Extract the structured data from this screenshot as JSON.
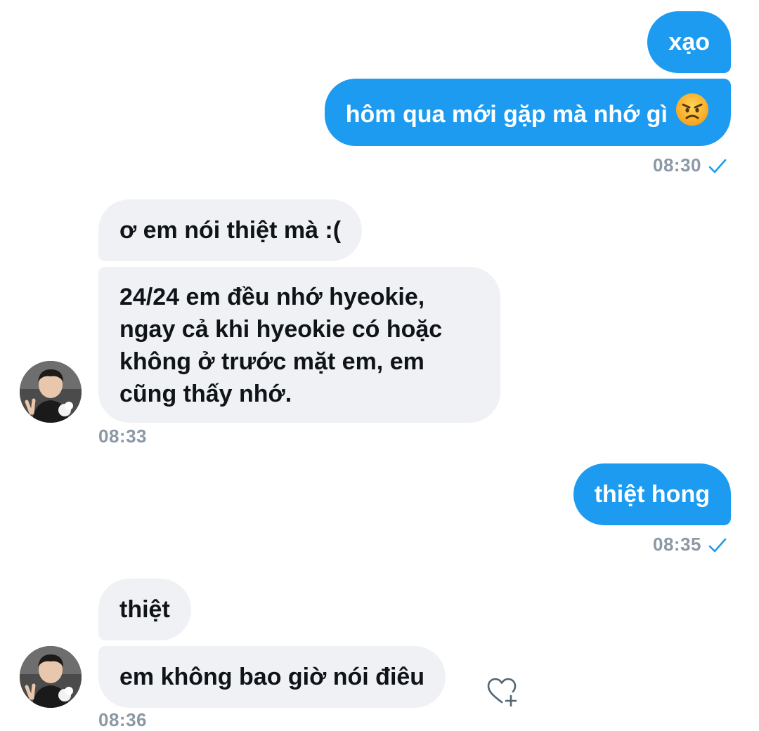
{
  "colors": {
    "outgoing_bubble": "#1d9bf0",
    "incoming_bubble": "#eff1f4",
    "timestamp": "#8b98a5",
    "read_check": "#1d9bf0"
  },
  "messages": [
    {
      "direction": "outgoing",
      "text": "xạo"
    },
    {
      "direction": "outgoing",
      "text": "hôm qua mới gặp mà nhớ gì",
      "emoji": "angry-face-icon",
      "time": "08:30"
    },
    {
      "direction": "incoming",
      "text": "ơ em nói thiệt mà :("
    },
    {
      "direction": "incoming",
      "lines": [
        "24/24 em đều nhớ hyeokie,",
        "ngay cả khi hyeokie có hoặc",
        "không ở trước mặt em, em",
        "cũng thấy nhớ."
      ],
      "time": "08:33"
    },
    {
      "direction": "outgoing",
      "text": "thiệt hong",
      "time": "08:35"
    },
    {
      "direction": "incoming",
      "text": "thiệt"
    },
    {
      "direction": "incoming",
      "text": "em không bao giờ nói điêu",
      "time": "08:36",
      "reaction_icon": "heart-add-icon"
    }
  ]
}
